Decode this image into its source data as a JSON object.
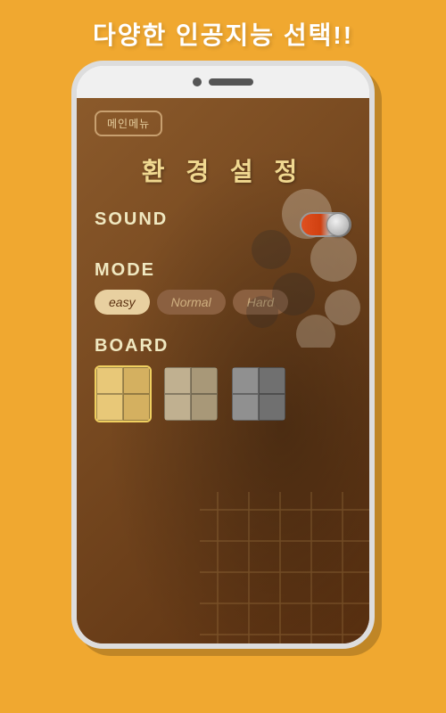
{
  "page": {
    "background_color": "#F0A830",
    "top_text": "다양한 인공지능 선택!!",
    "phone": {
      "main_menu_button": "메인메뉴",
      "settings_title": "환 경 설 정",
      "sound_label": "SOUND",
      "sound_on": true,
      "mode_label": "MODE",
      "mode_options": [
        "easy",
        "Normal",
        "Hard"
      ],
      "mode_selected": "easy",
      "board_label": "BOARD",
      "board_options": [
        "warm",
        "medium",
        "dark"
      ],
      "board_selected": "warm"
    }
  }
}
